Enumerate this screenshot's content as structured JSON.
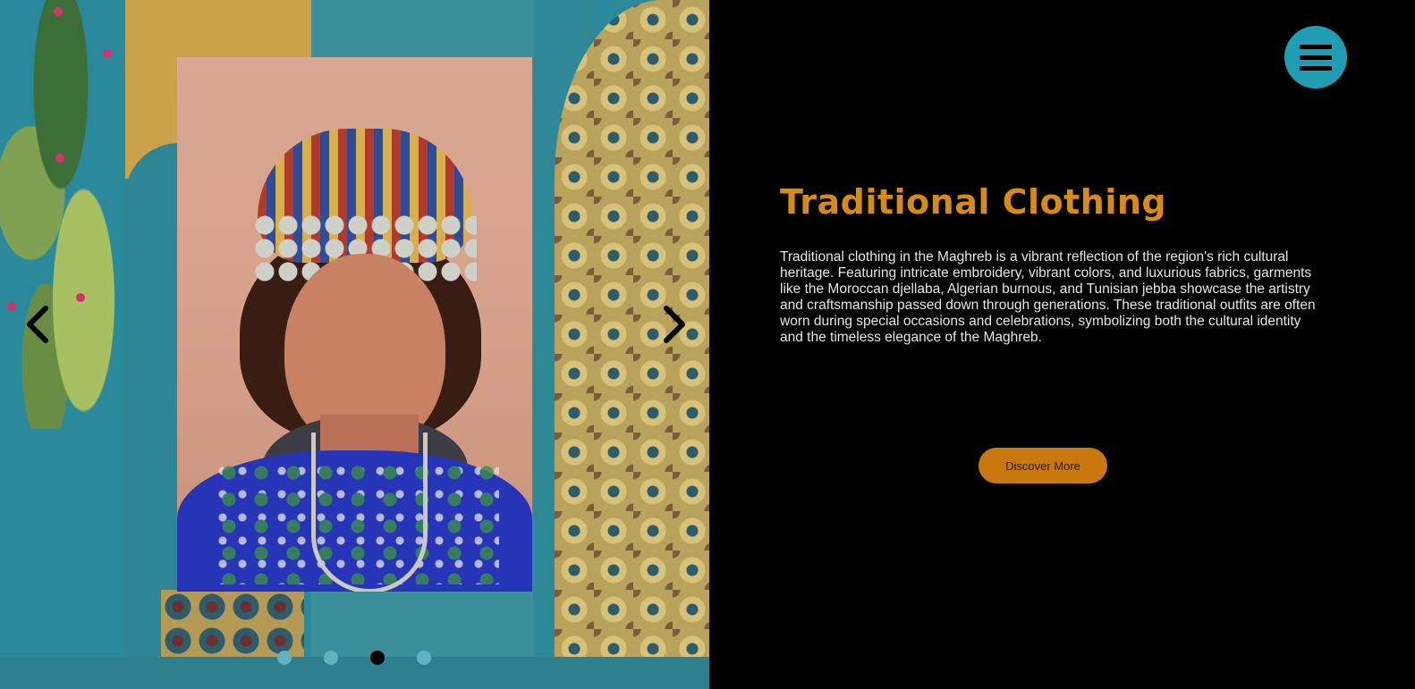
{
  "slider": {
    "current_index": 3,
    "total_slides": 4,
    "prev_icon": "chevron-left-icon",
    "next_icon": "chevron-right-icon",
    "dot_color": "#5fb4c4",
    "active_dot_color": "#000000"
  },
  "menu": {
    "icon": "hamburger-icon",
    "color": "#1f9eb3"
  },
  "content": {
    "title": "Traditional Clothing",
    "description": "Traditional clothing in the Maghreb is a vibrant reflection of the region's rich cultural heritage. Featuring intricate embroidery, vibrant colors, and luxurious fabrics, garments like the Moroccan djellaba, Algerian burnous, and Tunisian jebba showcase the artistry and craftsmanship passed down through generations. These traditional outfits are often worn during special occasions and celebrations, symbolizing both the cultural identity and the timeless elegance of the Maghreb.",
    "button_label": "Discover More",
    "title_color": "#d98a12",
    "button_color": "#c9780d"
  }
}
